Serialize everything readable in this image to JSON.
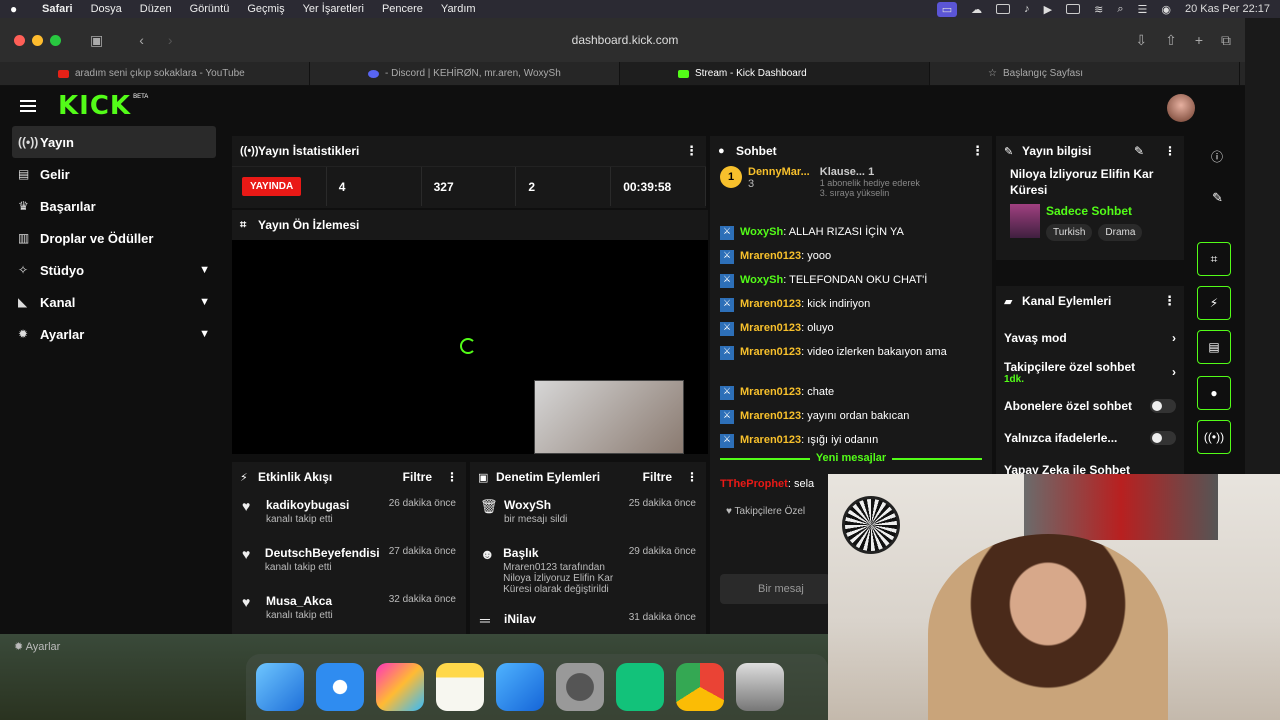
{
  "menubar": {
    "app": "Safari",
    "items": [
      "Dosya",
      "Düzen",
      "Görüntü",
      "Geçmiş",
      "Yer İşaretleri",
      "Pencere",
      "Yardım"
    ],
    "clock": "20 Kas Per  22:17"
  },
  "browser": {
    "url": "dashboard.kick.com",
    "tabs": [
      {
        "title": "aradım seni çıkıp sokaklara - YouTube",
        "color": "#e62117"
      },
      {
        "title": "- Discord | KEHİRØN, mr.aren, WoxySh",
        "color": "#5865f2"
      },
      {
        "title": "Stream - Kick Dashboard",
        "color": "#53fc18"
      },
      {
        "title": "Başlangıç Sayfası",
        "color": "#777777"
      }
    ]
  },
  "kick": {
    "logo": "KICK",
    "beta": "BETA",
    "accent": "#53fc18",
    "sidebar": [
      {
        "label": "Yayın",
        "icon": "broadcast-icon"
      },
      {
        "label": "Gelir",
        "icon": "wallet-icon"
      },
      {
        "label": "Başarılar",
        "icon": "trophy-icon"
      },
      {
        "label": "Droplar ve Ödüller",
        "icon": "gift-icon"
      },
      {
        "label": "Stüdyo",
        "icon": "studio-icon"
      },
      {
        "label": "Kanal",
        "icon": "channel-icon"
      },
      {
        "label": "Ayarlar",
        "icon": "gear-icon"
      }
    ],
    "stats": {
      "title": "Yayın İstatistikleri",
      "live": "YAYINDA",
      "values": [
        "4",
        "327",
        "2",
        "00:39:58"
      ]
    },
    "preview_title": "Yayın Ön İzlemesi",
    "activity": {
      "title": "Etkinlik Akışı",
      "filter": "Filtre",
      "rows": [
        {
          "name": "kadikoybugasi",
          "sub": "kanalı takip etti",
          "time": "26 dakika önce"
        },
        {
          "name": "DeutschBeyefendisi",
          "sub": "kanalı takip etti",
          "time": "27 dakika önce"
        },
        {
          "name": "Musa_Akca",
          "sub": "kanalı takip etti",
          "time": "32 dakika önce"
        }
      ]
    },
    "moderation": {
      "title": "Denetim Eylemleri",
      "filter": "Filtre",
      "rows": [
        {
          "name": "WoxySh",
          "sub": "bir mesajı sildi",
          "time": "25 dakika önce"
        },
        {
          "name": "Başlık",
          "sub": "Mraren0123 tarafından Niloya İzliyoruz Elifin Kar Küresi olarak değiştirildi",
          "time": "29 dakika önce"
        },
        {
          "name": "iNilav",
          "sub": "",
          "time": "31 dakika önce"
        }
      ]
    },
    "chat": {
      "title": "Sohbet",
      "pinned_user": "DennyMar...",
      "pinned_rank": "1",
      "pinned_count": "3",
      "gift_user": "Klause...",
      "gift_count": "1",
      "gift_text": "1 abonelik hediye ederek 3. sıraya yükselin",
      "messages": [
        {
          "user": "WoxySh",
          "text": ": ALLAH RIZASI İÇİN YA",
          "green": true
        },
        {
          "user": "Mraren0123",
          "text": ": yooo",
          "green": false
        },
        {
          "user": "WoxySh",
          "text": ": TELEFONDAN OKU CHAT'İ",
          "green": true
        },
        {
          "user": "Mraren0123",
          "text": ": kick indiriyon",
          "green": false
        },
        {
          "user": "Mraren0123",
          "text": ": oluyo",
          "green": false
        },
        {
          "user": "Mraren0123",
          "text": ": video izlerken bakaıyon ama",
          "green": false
        },
        {
          "user": "Mraren0123",
          "text": ": chate",
          "green": false
        },
        {
          "user": "Mraren0123",
          "text": ": yayını ordan bakıcan",
          "green": false
        },
        {
          "user": "Mraren0123",
          "text": ": ışığı iyi odanın",
          "green": false
        }
      ],
      "new_messages": "Yeni mesajlar",
      "last_user": "TTheProphet",
      "last_text": ": sela",
      "followers_note": "Takipçilere Özel",
      "input_placeholder": "Bir mesaj"
    },
    "info": {
      "title": "Yayın bilgisi",
      "stream_title": "Niloya İzliyoruz Elifin Kar Küresi",
      "category": "Sadece Sohbet",
      "tags": [
        "Turkish",
        "Drama"
      ]
    },
    "channel_actions": {
      "title": "Kanal Eylemleri",
      "items": [
        {
          "label": "Yavaş mod",
          "kind": "arrow",
          "sub": ""
        },
        {
          "label": "Takipçilere özel sohbet",
          "kind": "arrow",
          "sub": "1dk."
        },
        {
          "label": "Abonelere özel sohbet",
          "kind": "toggle",
          "sub": ""
        },
        {
          "label": "Yalnızca ifadelerle...",
          "kind": "toggle",
          "sub": ""
        },
        {
          "label": "Yapay Zeka ile Sohbet",
          "kind": "none",
          "sub": ""
        }
      ]
    },
    "settings_footer": "Ayarlar"
  }
}
